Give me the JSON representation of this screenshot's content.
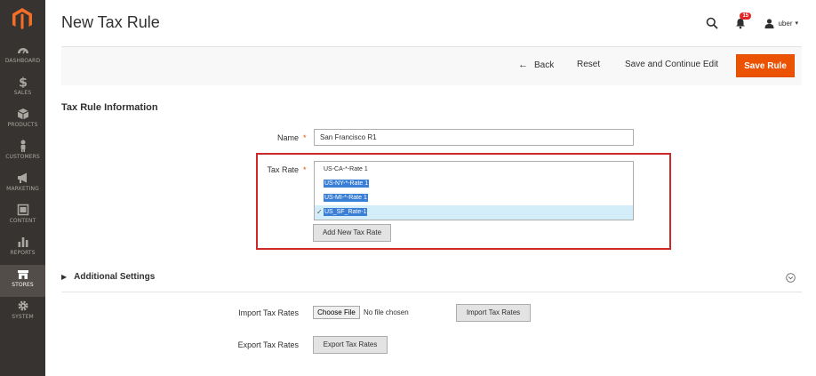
{
  "sidebar": {
    "items": [
      {
        "label": "DASHBOARD",
        "icon": "dashboard-icon"
      },
      {
        "label": "SALES",
        "icon": "dollar-icon"
      },
      {
        "label": "PRODUCTS",
        "icon": "box-icon"
      },
      {
        "label": "CUSTOMERS",
        "icon": "person-icon"
      },
      {
        "label": "MARKETING",
        "icon": "megaphone-icon"
      },
      {
        "label": "CONTENT",
        "icon": "content-icon"
      },
      {
        "label": "REPORTS",
        "icon": "bar-chart-icon"
      },
      {
        "label": "STORES",
        "icon": "store-icon",
        "active": true
      },
      {
        "label": "SYSTEM",
        "icon": "gear-icon"
      }
    ]
  },
  "header": {
    "title": "New Tax Rule",
    "notifications_count": "15",
    "user_name": "uber"
  },
  "actions": {
    "back_label": "Back",
    "reset_label": "Reset",
    "save_continue_label": "Save and Continue Edit",
    "save_rule_label": "Save Rule"
  },
  "form": {
    "section_title": "Tax Rule Information",
    "name_label": "Name",
    "name_value": "San Francisco R1",
    "tax_rate_label": "Tax Rate",
    "tax_rates": [
      {
        "label": "US-CA-*-Rate 1",
        "selected": false
      },
      {
        "label": "US-NY-*-Rate 1",
        "selected": true
      },
      {
        "label": "US-MI-*-Rate 1",
        "selected": true
      },
      {
        "label": "US_SF_Rate-1",
        "selected": true,
        "checked": true
      }
    ],
    "add_rate_label": "Add New Tax Rate"
  },
  "additional": {
    "title": "Additional Settings",
    "import_label": "Import Tax Rates",
    "choose_file_label": "Choose File",
    "no_file_text": "No file chosen",
    "import_button_label": "Import Tax Rates",
    "export_label": "Export Tax Rates",
    "export_button_label": "Export Tax Rates"
  },
  "colors": {
    "sidebar_bg": "#373330",
    "accent": "#eb5202",
    "selection": "#3a7fd6",
    "highlight_border": "#cc2a2a"
  }
}
